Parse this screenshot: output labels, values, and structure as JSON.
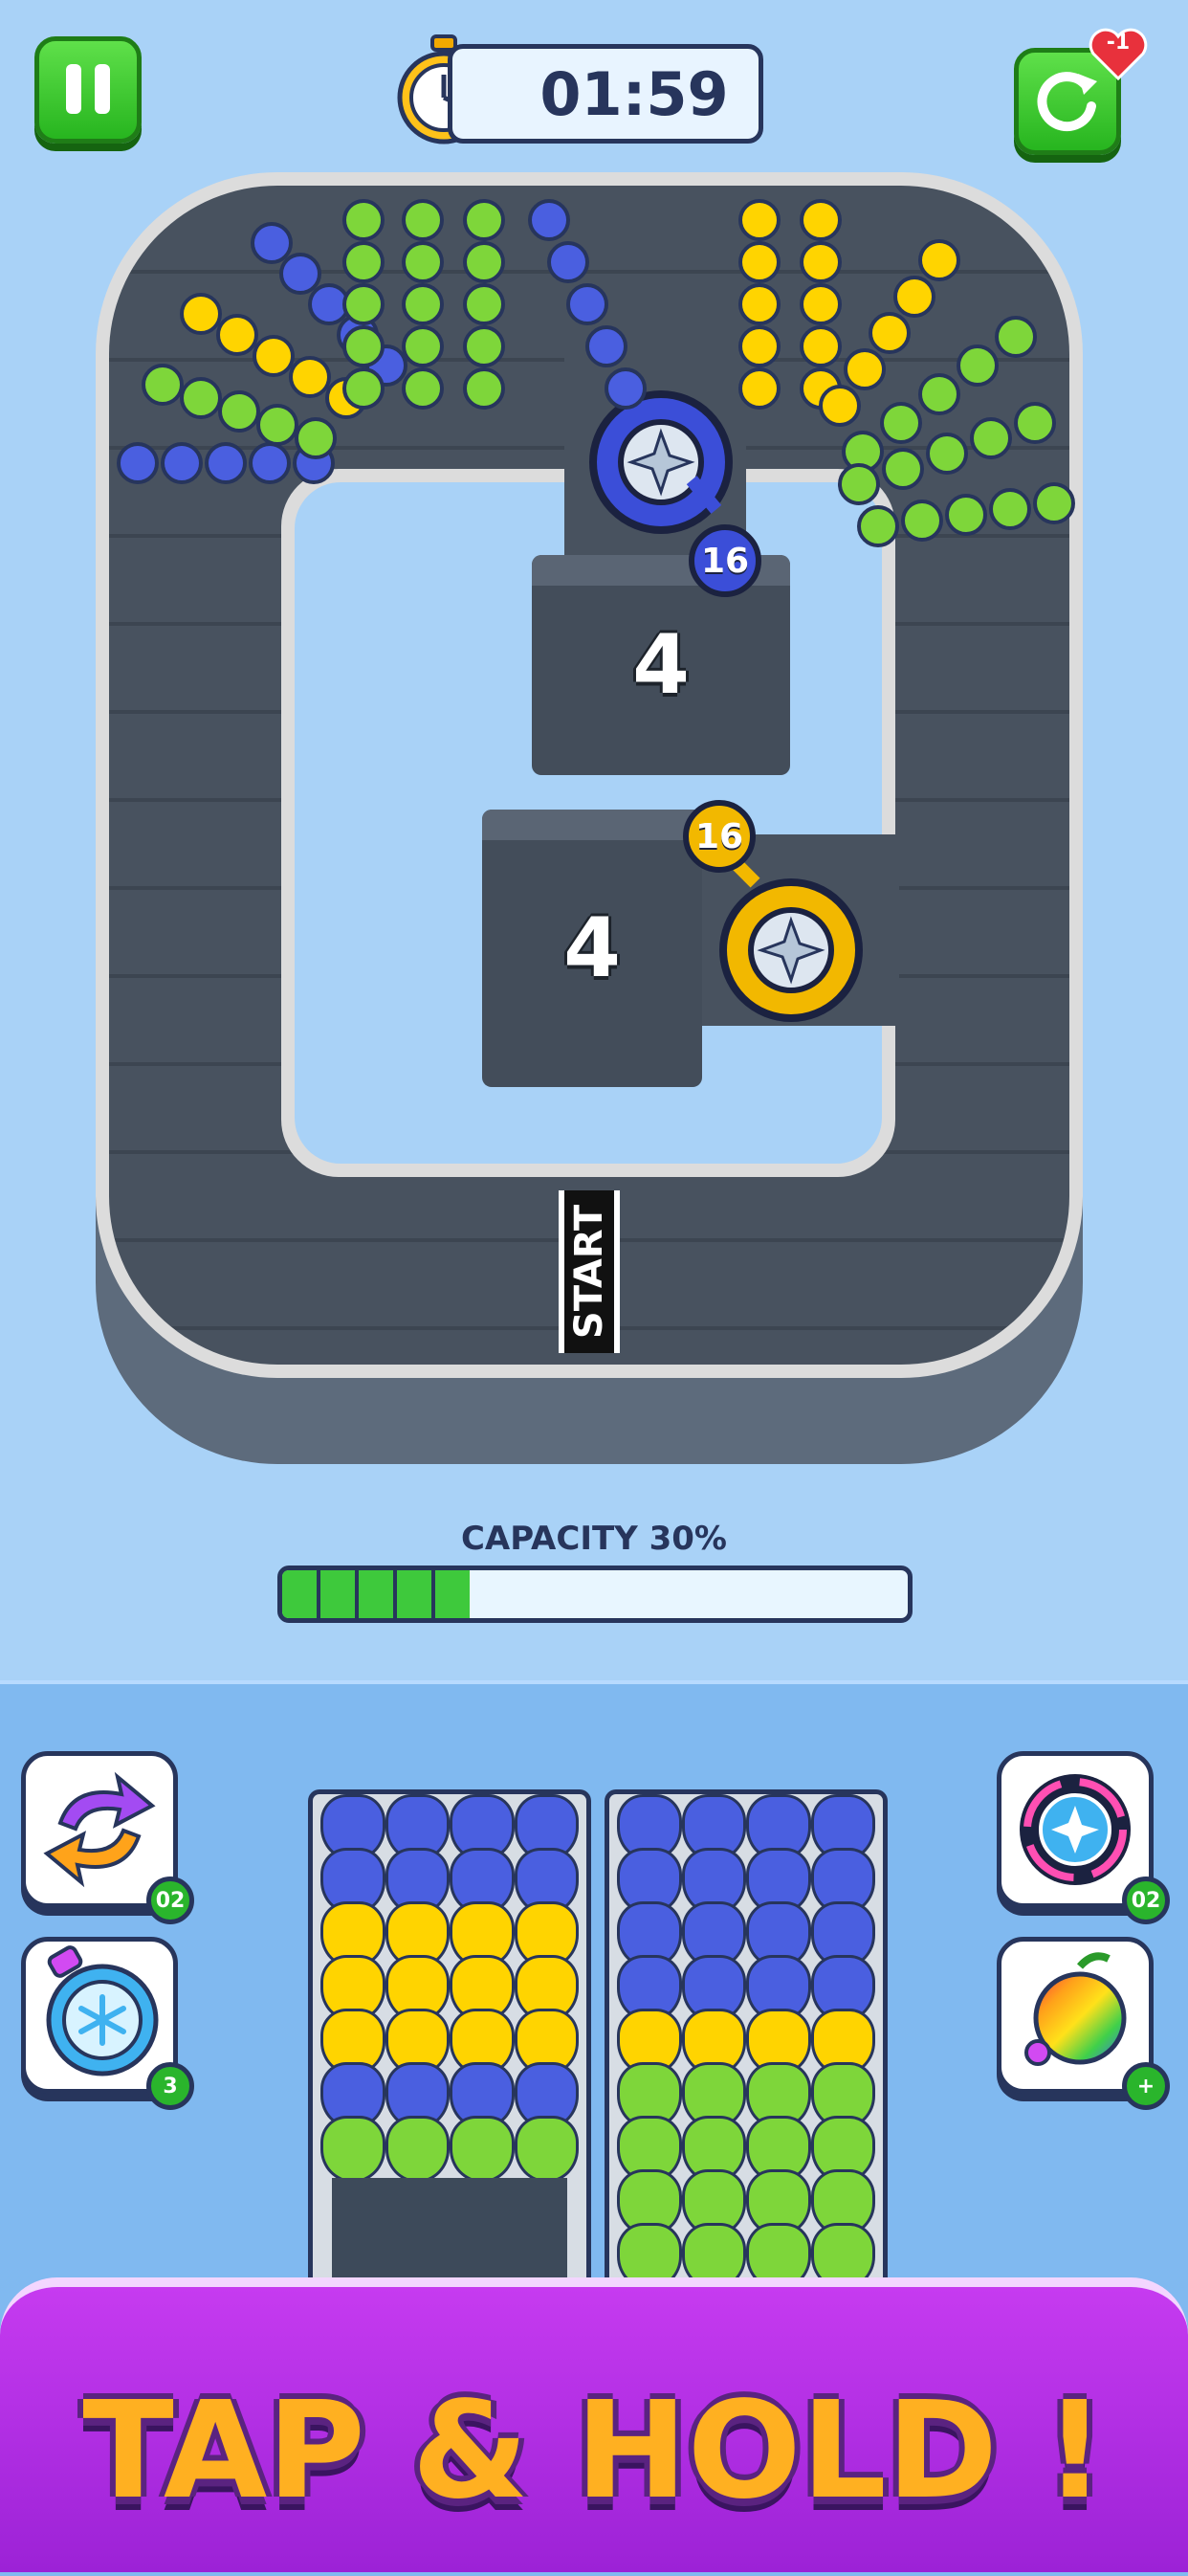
{
  "hud": {
    "timer": "01:59",
    "pause_icon": "pause-icon",
    "restart_icon": "restart-icon",
    "life_cost": "-1"
  },
  "board": {
    "start_label": "START",
    "bay_top_count": "4",
    "bay_mid_count": "4",
    "launcher_blue_count": "16",
    "launcher_yellow_count": "16",
    "colors": {
      "blue": "#4a5fe0",
      "yellow": "#ffd400",
      "green": "#7ed63a"
    }
  },
  "capacity": {
    "label": "CAPACITY 30%",
    "percent": 30
  },
  "tools": {
    "shuffle_count": "02",
    "freeze_count": "3",
    "spinner_count": "02",
    "rainbow_count": "+"
  },
  "columns": [
    {
      "rows": [
        "blue",
        "blue",
        "yellow",
        "yellow",
        "yellow",
        "blue",
        "green"
      ]
    },
    {
      "rows": [
        "blue",
        "blue",
        "blue",
        "blue",
        "yellow",
        "green",
        "green",
        "green",
        "green"
      ]
    }
  ],
  "banner": {
    "text": "TAP & HOLD !"
  }
}
